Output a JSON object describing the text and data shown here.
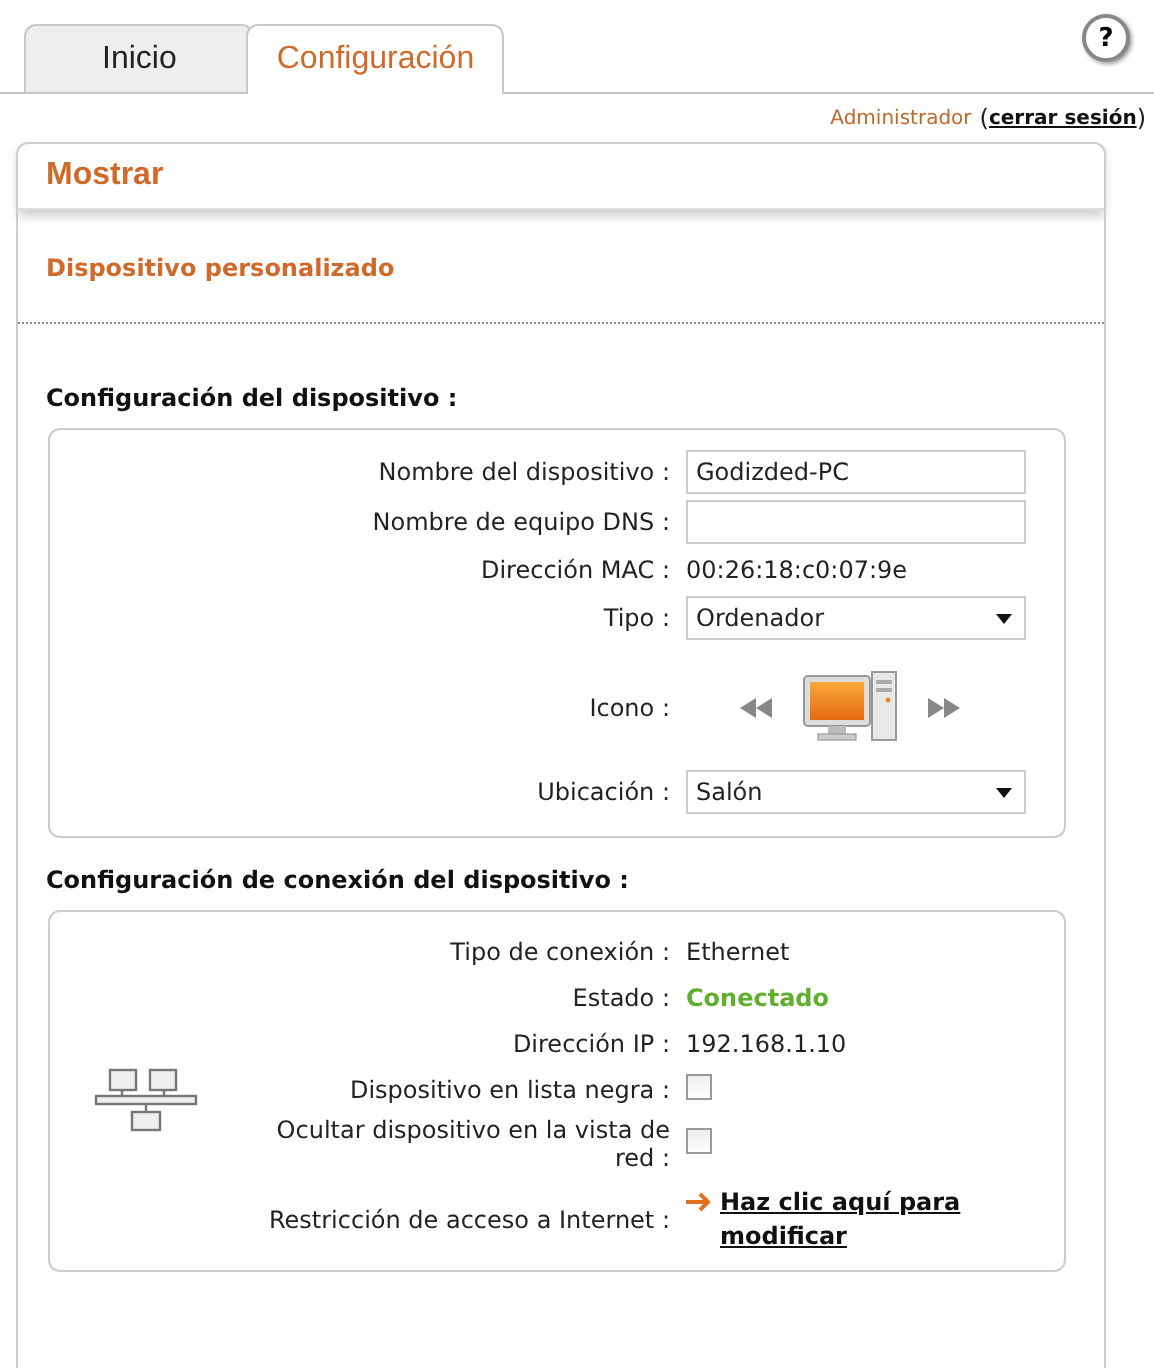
{
  "tabs": [
    {
      "label": "Inicio",
      "selected": false
    },
    {
      "label": "Configuración",
      "selected": true
    }
  ],
  "help": {
    "label": "?"
  },
  "user": {
    "name": "Administrador",
    "open": "(",
    "logout": "cerrar sesión",
    "close": ")"
  },
  "panel": {
    "title": "Mostrar",
    "subtitle": "Dispositivo personalizado"
  },
  "sections": [
    {
      "kind": "device",
      "title": "Configuración del dispositivo :",
      "rows": [
        {
          "kind": "input",
          "label": "Nombre del dispositivo :",
          "value": "Godizded-PC"
        },
        {
          "kind": "input",
          "label": "Nombre de equipo DNS :"
        },
        {
          "kind": "text",
          "label": "Dirección MAC :",
          "value": "00:26:18:c0:07:9e"
        },
        {
          "kind": "select",
          "label": "Tipo :",
          "value": "Ordenador"
        },
        {
          "kind": "icon",
          "label": "Icono :"
        },
        {
          "kind": "select",
          "label": "Ubicación :",
          "value": "Salón"
        }
      ]
    },
    {
      "title": "Configuración de conexión del dispositivo :",
      "kind": "connection",
      "rows": [
        {
          "kind": "text",
          "label": "Tipo de conexión :",
          "value": "Ethernet"
        },
        {
          "kind": "status",
          "label": "Estado :",
          "value": "Conectado",
          "color": "#5fae2e"
        },
        {
          "kind": "text",
          "label": "Dirección IP :",
          "value": "192.168.1.10"
        },
        {
          "kind": "checkbox",
          "label": "Dispositivo en lista negra :",
          "checked": false
        },
        {
          "kind": "checkbox",
          "label": "Ocultar dispositivo en la vista de red :",
          "checked": false
        },
        {
          "kind": "link",
          "label": "Restricción de acceso a Internet :",
          "value": "Haz clic aquí para modificar"
        }
      ]
    }
  ]
}
